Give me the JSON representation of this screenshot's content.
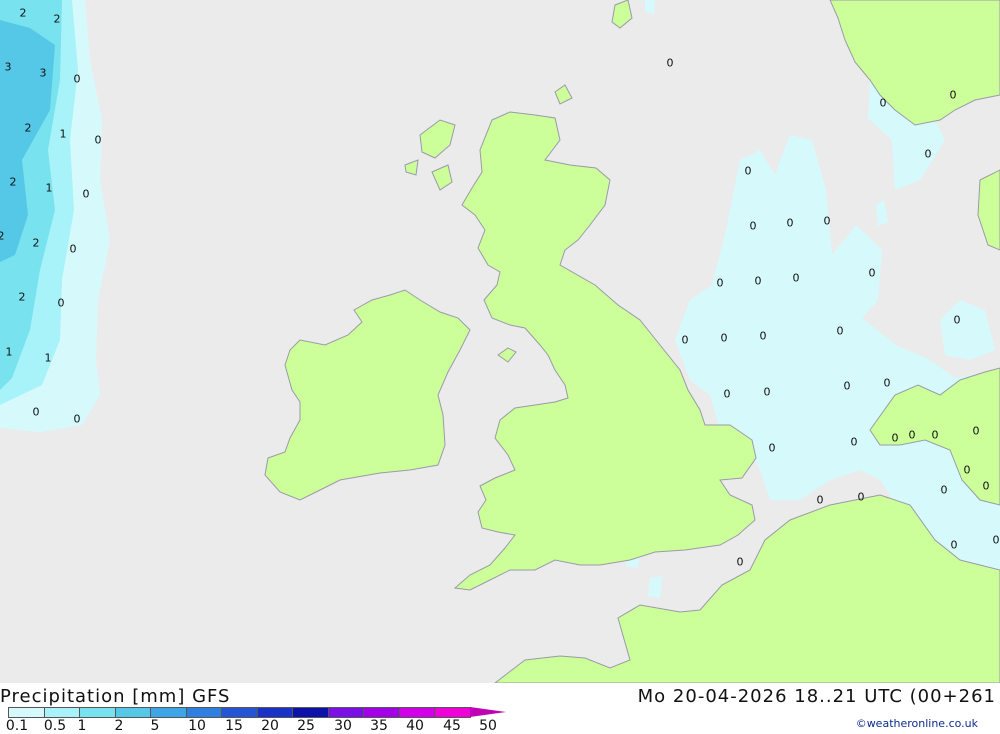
{
  "title": "Precipitation [mm] GFS",
  "datetime": "Mo 20-04-2026 18..21 UTC (00+261",
  "copyright": "©weatheronline.co.uk",
  "colors": {
    "sea": "#ebebeb",
    "land": "#ccff99",
    "coast": "#9a9aa8",
    "precip_light": "#d6fafc",
    "precip_0_5": "#a7f3f9",
    "precip_1": "#78e3ef",
    "precip_2": "#55c8e8"
  },
  "legend": {
    "labels": [
      "0.1",
      "0.5",
      "1",
      "2",
      "5",
      "10",
      "15",
      "20",
      "25",
      "30",
      "35",
      "40",
      "45",
      "50"
    ],
    "colors": [
      "#d6fafc",
      "#a7f3f9",
      "#78e3ef",
      "#55c8e8",
      "#3ea6e6",
      "#2f7fe0",
      "#2456d4",
      "#1b32c6",
      "#0c12a6",
      "#7a10e6",
      "#a400e8",
      "#d100e8",
      "#f000d8",
      "#c000b4"
    ]
  },
  "grid_values": [
    {
      "text": "2"
    },
    {
      "text": "2"
    },
    {
      "text": "3"
    },
    {
      "text": "3"
    },
    {
      "text": "0"
    },
    {
      "text": "2"
    },
    {
      "text": "1"
    },
    {
      "text": "0"
    },
    {
      "text": "2"
    },
    {
      "text": "1"
    },
    {
      "text": "0"
    },
    {
      "text": "2"
    },
    {
      "text": "2"
    },
    {
      "text": "0"
    },
    {
      "text": "2"
    },
    {
      "text": "0"
    },
    {
      "text": "1"
    },
    {
      "text": "1"
    },
    {
      "text": "0"
    },
    {
      "text": "0"
    },
    {
      "text": "0"
    },
    {
      "text": "0"
    },
    {
      "text": "0"
    },
    {
      "text": "0"
    },
    {
      "text": "0"
    },
    {
      "text": "0"
    },
    {
      "text": "0"
    },
    {
      "text": "0"
    },
    {
      "text": "0"
    },
    {
      "text": "0"
    },
    {
      "text": "0"
    },
    {
      "text": "0"
    },
    {
      "text": "0"
    },
    {
      "text": "0"
    },
    {
      "text": "0"
    },
    {
      "text": "0"
    },
    {
      "text": "0"
    },
    {
      "text": "0"
    },
    {
      "text": "0"
    },
    {
      "text": "0"
    },
    {
      "text": "0"
    },
    {
      "text": "0"
    },
    {
      "text": "0"
    },
    {
      "text": "0"
    },
    {
      "text": "0"
    },
    {
      "text": "0"
    },
    {
      "text": "0"
    },
    {
      "text": "0"
    },
    {
      "text": "0"
    },
    {
      "text": "0"
    },
    {
      "text": "0"
    },
    {
      "text": "0"
    },
    {
      "text": "0"
    },
    {
      "text": "0"
    },
    {
      "text": "0"
    }
  ]
}
